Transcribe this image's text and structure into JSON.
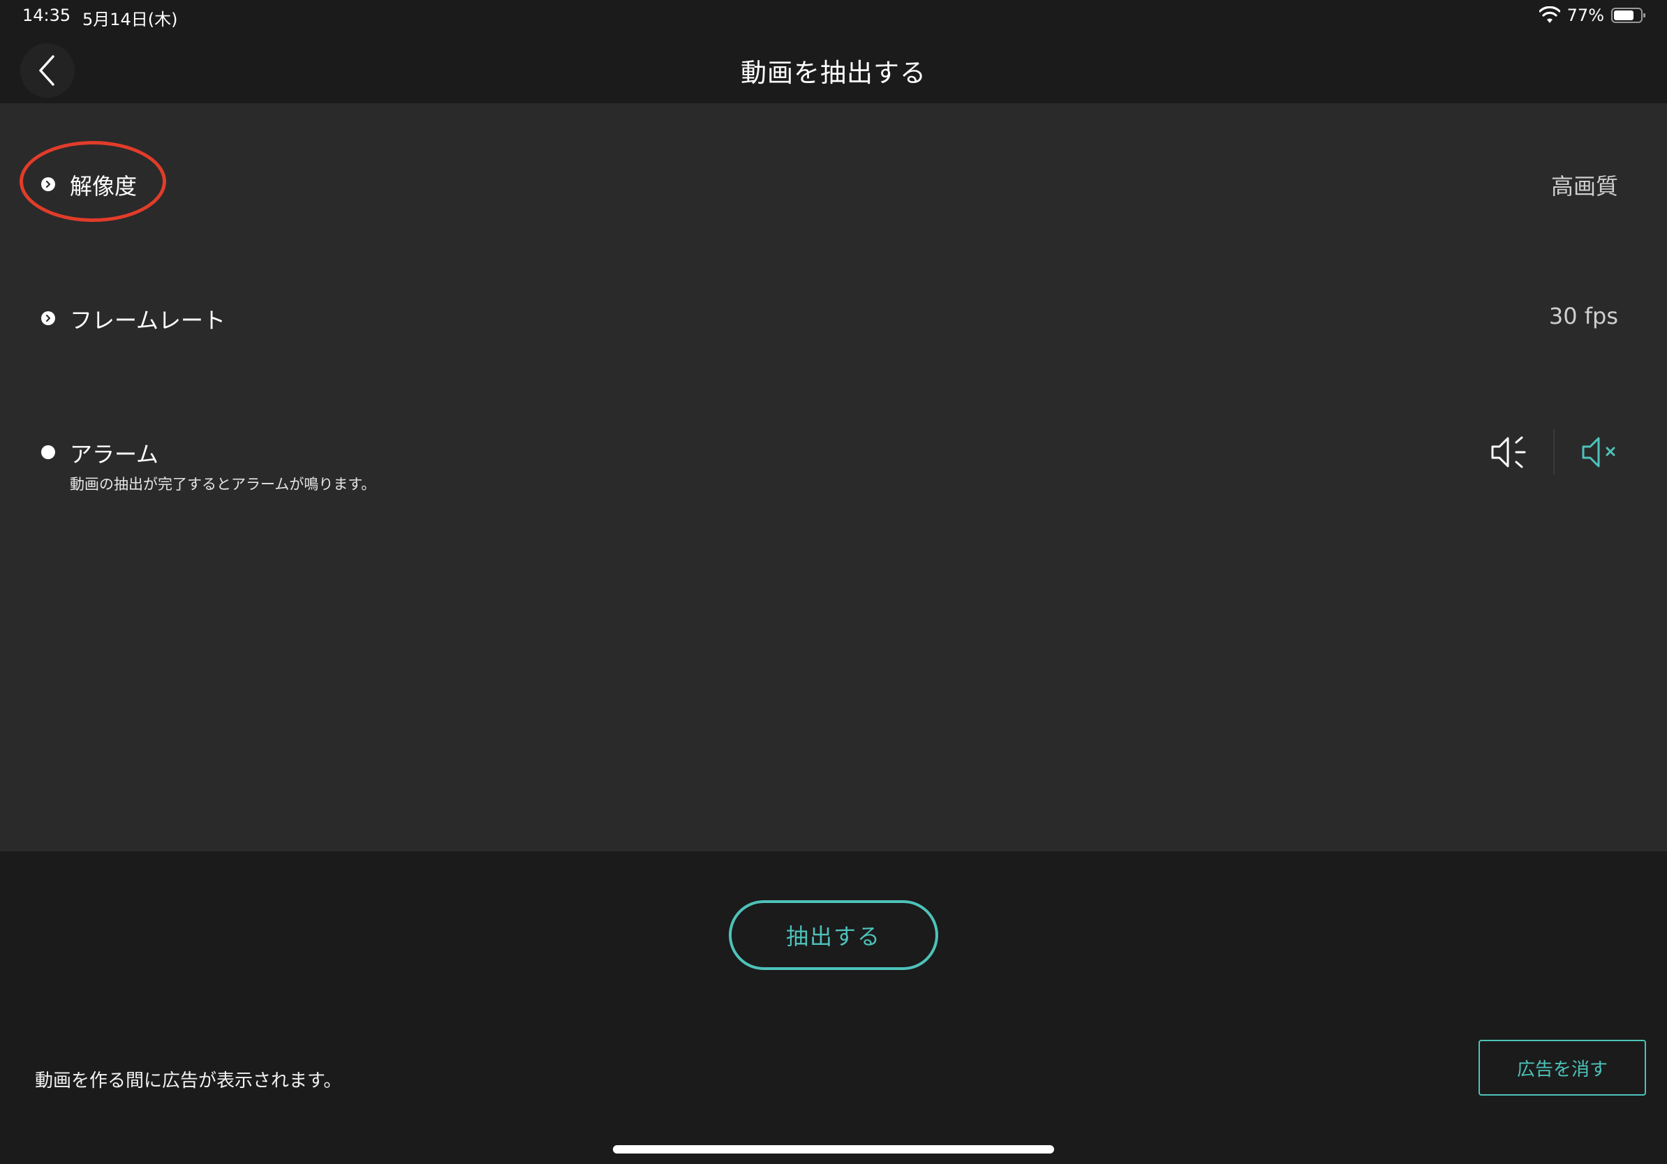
{
  "status_bar": {
    "time": "14:35",
    "date": "5月14日(木)",
    "battery_percent": "77%",
    "battery_level": 0.77,
    "wifi_icon": "wifi-icon",
    "battery_icon": "battery-icon"
  },
  "header": {
    "title": "動画を抽出する",
    "back_icon": "chevron-left-icon"
  },
  "settings": {
    "resolution": {
      "label": "解像度",
      "value": "高画質"
    },
    "frame_rate": {
      "label": "フレームレート",
      "value": "30 fps"
    },
    "alarm": {
      "label": "アラーム",
      "description": "動画の抽出が完了するとアラームが鳴ります。",
      "sound_on_icon": "speaker-on-icon",
      "sound_off_icon": "speaker-mute-icon",
      "selected": "mute"
    }
  },
  "extract": {
    "button_label": "抽出する"
  },
  "ad": {
    "message": "動画を作る間に広告が表示されます。",
    "remove_label": "広告を消す"
  },
  "colors": {
    "accent": "#4ec2ba",
    "annotation": "#e23c2a",
    "panel_bg": "#2a2a2a",
    "app_bg": "#1b1b1b"
  }
}
